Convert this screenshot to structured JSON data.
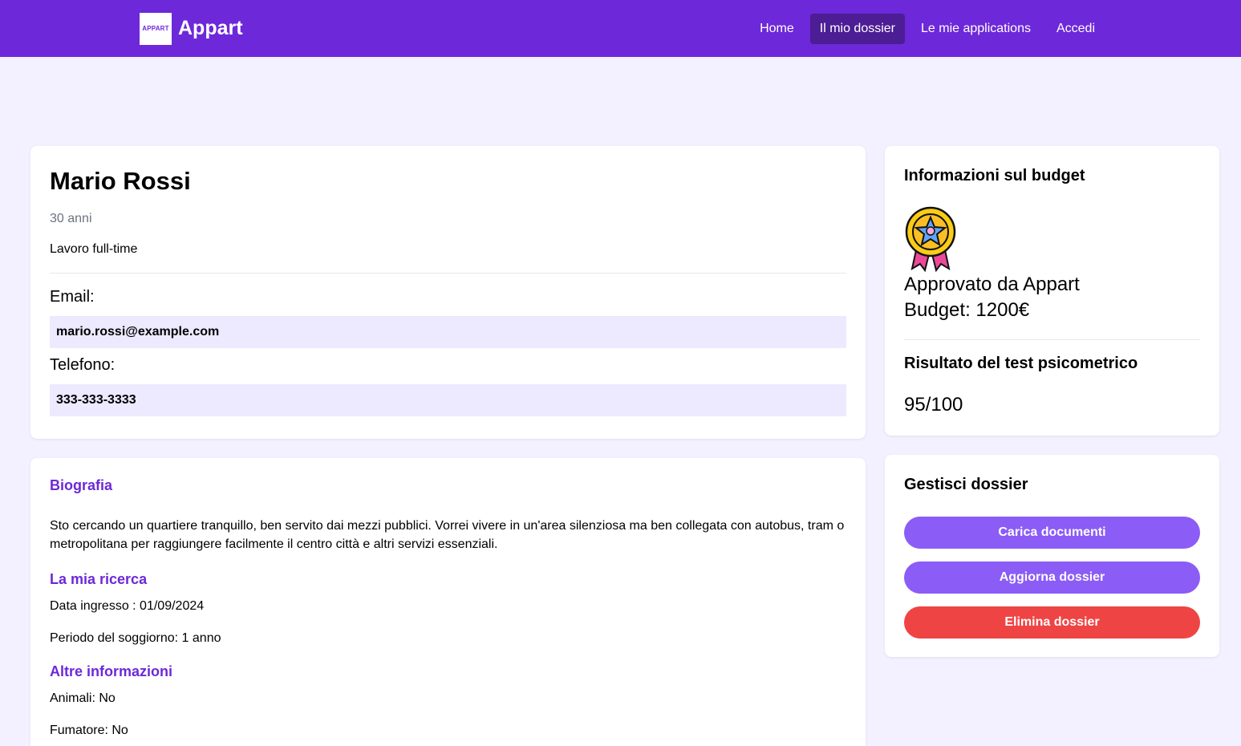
{
  "header": {
    "logo_text": "APPART",
    "brand": "Appart",
    "nav": [
      {
        "label": "Home"
      },
      {
        "label": "Il mio dossier"
      },
      {
        "label": "Le mie applications"
      },
      {
        "label": "Accedi"
      }
    ],
    "active_nav": "Il mio dossier"
  },
  "profile": {
    "name": "Mario Rossi",
    "age": "30 anni",
    "job": "Lavoro full-time",
    "email_label": "Email:",
    "email": "mario.rossi@example.com",
    "phone_label": "Telefono:",
    "phone": "333-333-3333"
  },
  "bio": {
    "title": "Biografia",
    "text": "Sto cercando un quartiere tranquillo, ben servito dai mezzi pubblici. Vorrei vivere in un'area silenziosa ma ben collegata con autobus, tram o metropolitana per raggiungere facilmente il centro città e altri servizi essenziali.",
    "search_title": "La mia ricerca",
    "move_in": "Data ingresso : 01/09/2024",
    "period": "Periodo del soggiorno: 1 anno",
    "other_title": "Altre informazioni",
    "pets": "Animali: No",
    "smoker": "Fumatore: No"
  },
  "budget": {
    "title": "Informazioni sul budget",
    "badge_icon": "award-medal-icon",
    "approved": "Approvato da Appart",
    "budget": "Budget: 1200€",
    "test_title": "Risultato del test psicometrico",
    "score": "95/100"
  },
  "manage": {
    "title": "Gestisci dossier",
    "upload": "Carica documenti",
    "update": "Aggiorna dossier",
    "delete": "Elimina dossier"
  },
  "colors": {
    "primary": "#6d28d9",
    "nav_active": "#4c1d95",
    "button_purple": "#8b5cf6",
    "button_red": "#ef4444",
    "field_bg": "#ede9fe",
    "page_bg": "#f3f1ff"
  }
}
